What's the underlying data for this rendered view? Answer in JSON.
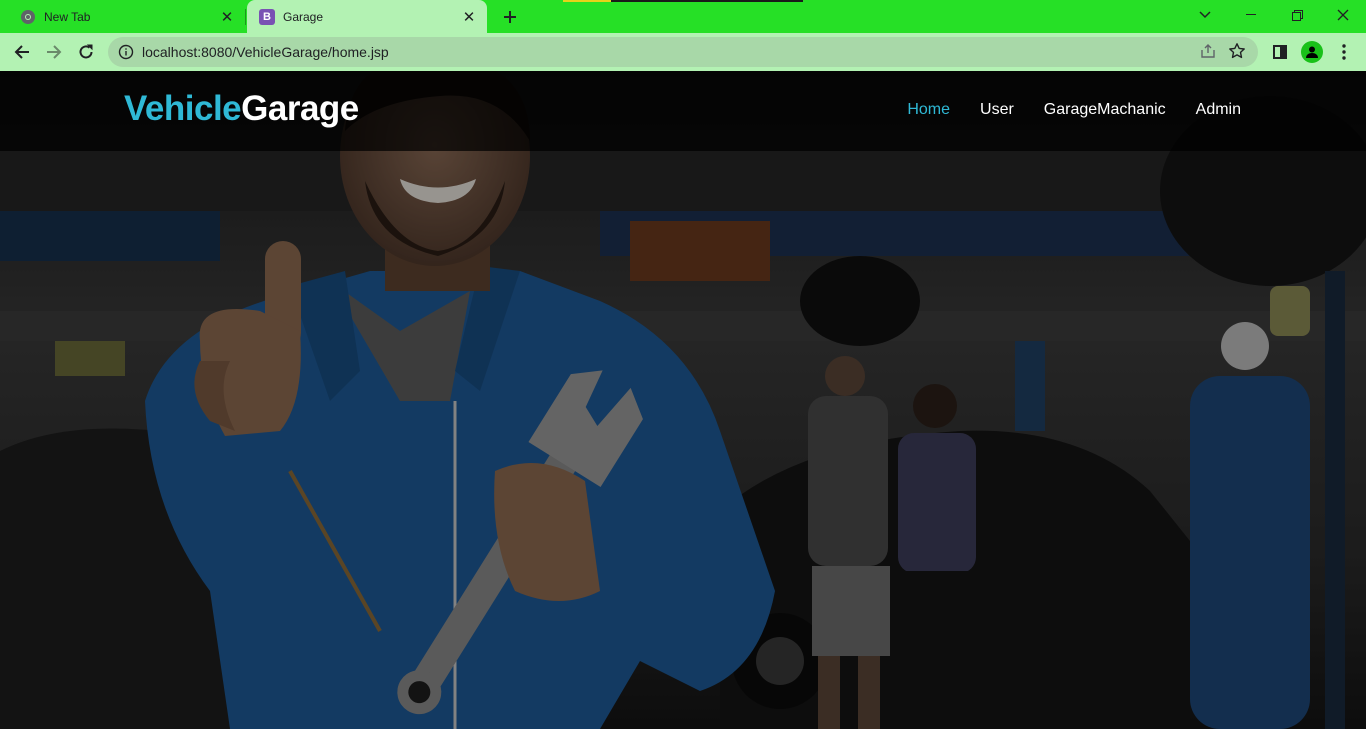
{
  "browser": {
    "tabs": [
      {
        "title": "New Tab",
        "active": false
      },
      {
        "title": "Garage",
        "active": true
      }
    ],
    "favicon_active_letter": "B",
    "url": "localhost:8080/VehicleGarage/home.jsp",
    "colors": {
      "tabstrip": "#26e026",
      "toolbar": "#b3f2b3",
      "omnibox": "#a8d8a8"
    }
  },
  "site": {
    "brand_part1": "Vehicle",
    "brand_part2": "Garage",
    "brand_colors": {
      "accent": "#2fb9d6",
      "primary": "#ffffff"
    },
    "nav": [
      {
        "label": "Home",
        "active": true
      },
      {
        "label": "User",
        "active": false
      },
      {
        "label": "GarageMachanic",
        "active": false
      },
      {
        "label": "Admin",
        "active": false
      }
    ],
    "hero_image": "mechanic-thumbs-up-holding-wrench-in-garage"
  }
}
